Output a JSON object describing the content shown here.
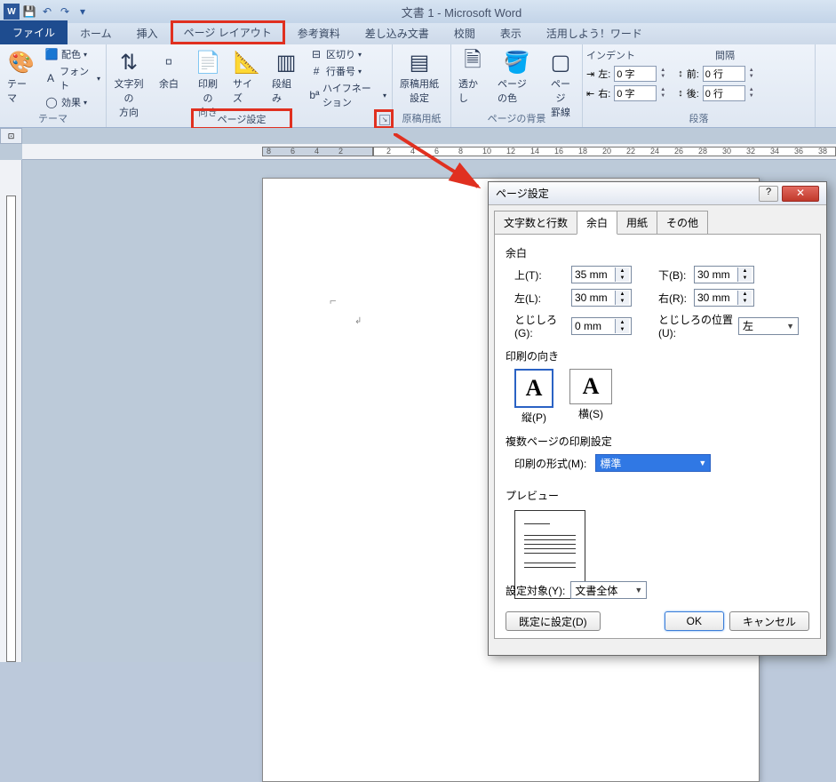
{
  "title": "文書 1 - Microsoft Word",
  "tabs": {
    "file": "ファイル",
    "home": "ホーム",
    "insert": "挿入",
    "page_layout": "ページ レイアウト",
    "references": "参考資料",
    "mailings": "差し込み文書",
    "review": "校閲",
    "view": "表示",
    "use": "活用しよう！ワード"
  },
  "ribbon": {
    "themes": {
      "label": "テーマ",
      "theme": "テーマ",
      "colors": "配色",
      "fonts": "フォント",
      "effects": "効果"
    },
    "page_setup": {
      "label": "ページ設定",
      "text_direction": "文字列の\n方向",
      "margins": "余白",
      "orientation": "印刷の\n向き",
      "size": "サイズ",
      "columns": "段組み",
      "breaks": "区切り",
      "line_numbers": "行番号",
      "hyphenation": "ハイフネーション"
    },
    "manuscript": {
      "label": "原稿用紙",
      "setting": "原稿用紙\n設定"
    },
    "background": {
      "label": "ページの背景",
      "watermark": "透かし",
      "color": "ページの色",
      "borders": "ページ\n罫線"
    },
    "paragraph": {
      "label": "段落",
      "indent_title": "インデント",
      "spacing_title": "間隔",
      "left_label": "左:",
      "right_label": "右:",
      "before_label": "前:",
      "after_label": "後:",
      "left_value": "0 字",
      "right_value": "0 字",
      "before_value": "0 行",
      "after_value": "0 行"
    }
  },
  "highlight": {
    "page_setup": "ページ設定"
  },
  "ruler_nums": [
    "8",
    "6",
    "4",
    "2",
    "",
    "2",
    "4",
    "6",
    "8",
    "10",
    "12",
    "14",
    "16",
    "18",
    "20",
    "22",
    "24",
    "26",
    "28",
    "30",
    "32",
    "34",
    "36",
    "38"
  ],
  "dialog": {
    "title": "ページ設定",
    "tabs": {
      "chars": "文字数と行数",
      "margins": "余白",
      "paper": "用紙",
      "other": "その他"
    },
    "section_margin": "余白",
    "top_label": "上(T):",
    "top_value": "35 mm",
    "bottom_label": "下(B):",
    "bottom_value": "30 mm",
    "left_label": "左(L):",
    "left_value": "30 mm",
    "right_label": "右(R):",
    "right_value": "30 mm",
    "gutter_label": "とじしろ(G):",
    "gutter_value": "0 mm",
    "gutter_pos_label": "とじしろの位置(U):",
    "gutter_pos_value": "左",
    "section_orient": "印刷の向き",
    "portrait": "縦(P)",
    "landscape": "横(S)",
    "multi_page": "複数ページの印刷設定",
    "format_label": "印刷の形式(M):",
    "format_value": "標準",
    "preview": "プレビュー",
    "apply_label": "設定対象(Y):",
    "apply_value": "文書全体",
    "default_btn": "既定に設定(D)",
    "ok": "OK",
    "cancel": "キャンセル"
  }
}
